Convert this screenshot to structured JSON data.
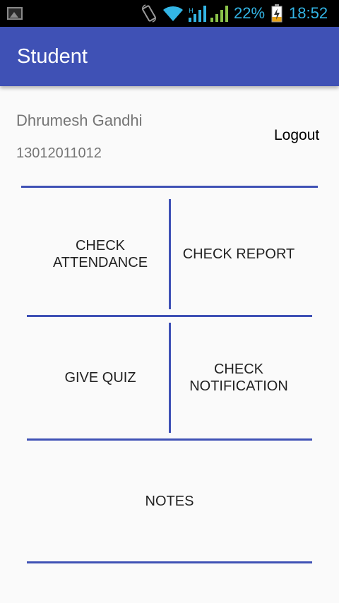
{
  "status_bar": {
    "battery_percent": "22%",
    "time": "18:52",
    "icons": [
      "image-notification-icon",
      "screen-rotation-icon",
      "wifi-icon",
      "signal-icon",
      "signal-icon",
      "battery-charging-icon"
    ],
    "accent_color": "#33b5e5"
  },
  "app_bar": {
    "title": "Student",
    "color": "#3f51b5"
  },
  "profile": {
    "name": "Dhrumesh Gandhi",
    "id": "13012011012",
    "logout_label": "Logout"
  },
  "menu": {
    "check_attendance": "CHECK ATTENDANCE",
    "check_report": "CHECK REPORT",
    "give_quiz": "GIVE QUIZ",
    "check_notification": "CHECK NOTIFICATION",
    "notes": "NOTES"
  }
}
